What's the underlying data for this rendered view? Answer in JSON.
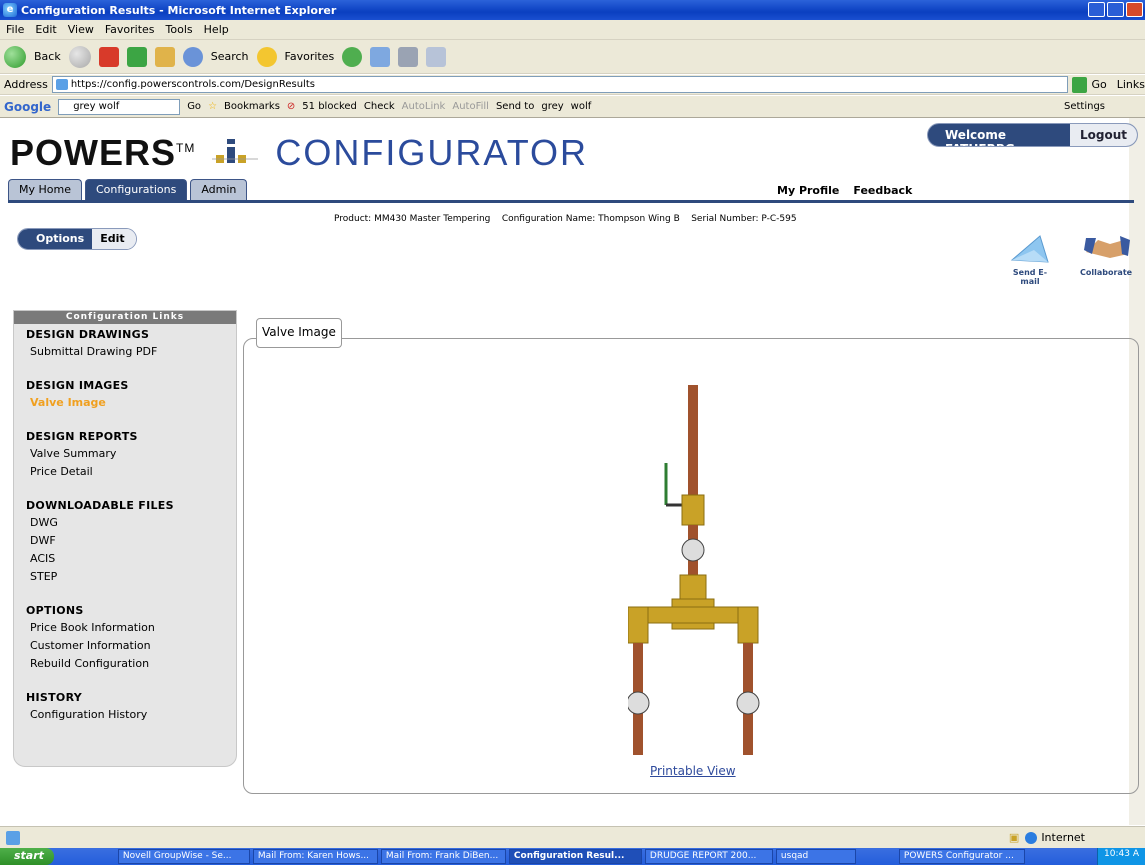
{
  "window": {
    "title": "Configuration Results - Microsoft Internet Explorer"
  },
  "menu": [
    "File",
    "Edit",
    "View",
    "Favorites",
    "Tools",
    "Help"
  ],
  "toolbar": {
    "back": "Back",
    "search": "Search",
    "favorites": "Favorites"
  },
  "address": {
    "label": "Address",
    "url": "https://config.powerscontrols.com/DesignResults",
    "go": "Go",
    "links": "Links"
  },
  "google": {
    "search_text": "grey wolf",
    "go": "Go",
    "bookmarks": "Bookmarks",
    "blocked": "51 blocked",
    "check": "Check",
    "autolink": "AutoLink",
    "autofill": "AutoFill",
    "sendto": "Send to",
    "grey": "grey",
    "wolf": "wolf",
    "settings": "Settings"
  },
  "brand": {
    "powers": "POWERS",
    "tm": "TM",
    "configurator": "CONFIGURATOR"
  },
  "user": {
    "welcome": "Welcome FATHERBG",
    "logout": "Logout"
  },
  "tabs": [
    "My Home",
    "Configurations",
    "Admin"
  ],
  "topnav": {
    "profile": "My Profile",
    "feedback": "Feedback"
  },
  "product_line": "Product: MM430 Master Tempering    Configuration Name: Thompson Wing B    Serial Number: P-C-595",
  "options_edit": {
    "options": "Options",
    "edit": "Edit"
  },
  "actions": {
    "send_email": "Send E-mail",
    "collaborate": "Collaborate"
  },
  "sidebar": {
    "header": "Configuration Links",
    "sections": [
      {
        "title": "DESIGN DRAWINGS",
        "links": [
          "Submittal Drawing PDF"
        ]
      },
      {
        "title": "DESIGN IMAGES",
        "links": [
          "Valve Image"
        ]
      },
      {
        "title": "DESIGN REPORTS",
        "links": [
          "Valve Summary",
          "Price Detail"
        ]
      },
      {
        "title": "DOWNLOADABLE FILES",
        "links": [
          "DWG",
          "DWF",
          "ACIS",
          "STEP"
        ]
      },
      {
        "title": "OPTIONS",
        "links": [
          "Price Book Information",
          "Customer Information",
          "Rebuild Configuration"
        ]
      },
      {
        "title": "HISTORY",
        "links": [
          "Configuration History"
        ]
      }
    ]
  },
  "panel": {
    "tab": "Valve Image",
    "printable": "Printable View"
  },
  "status": {
    "zone": "Internet"
  },
  "taskbar": {
    "start": "start",
    "tasks": [
      "Novell GroupWise - Se...",
      "Mail From: Karen Hows...",
      "Mail From: Frank DiBen...",
      "Configuration Resul...",
      "DRUDGE REPORT 200...",
      "usqad",
      "POWERS Configurator ..."
    ],
    "clock": "10:43 A"
  },
  "colors": {
    "brand_blue": "#2e4a7d",
    "active_link": "#f0a020",
    "copper": "#a0522d",
    "brass": "#c9a227"
  }
}
